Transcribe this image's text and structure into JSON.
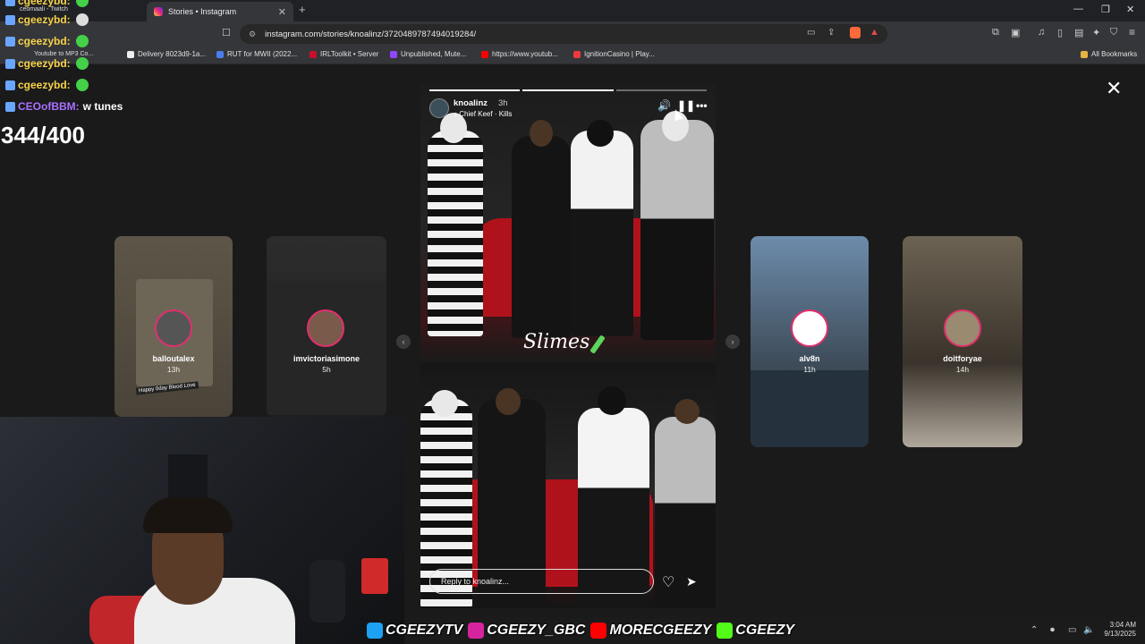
{
  "browser": {
    "tab_title": "Stories • Instagram",
    "tab_close": "✕",
    "new_tab": "+",
    "url": "instagram.com/stories/knoalinz/3720489787494019284/",
    "bookmarks": [
      {
        "label": "Delivery 8023d9-1a..."
      },
      {
        "label": "RUT for MWII (2022..."
      },
      {
        "label": "IRLToolkit • Server"
      },
      {
        "label": "Unpublished, Mute..."
      },
      {
        "label": "https://www.youtub..."
      },
      {
        "label": "IgnitionCasino | Play..."
      }
    ],
    "all_bookmarks": "All Bookmarks"
  },
  "overlay": {
    "small_lines": [
      "ceomaali - Twitch",
      "Youtube to MP3 Co..."
    ],
    "chat": [
      {
        "name": "cgeezybd:",
        "message": ""
      },
      {
        "name": "cgeezybd:",
        "message": ""
      },
      {
        "name": "cgeezybd:",
        "message": ""
      },
      {
        "name": "cgeezybd:",
        "message": ""
      },
      {
        "name": "CEOofBBM:",
        "message": "w tunes"
      }
    ],
    "counter": "344/400"
  },
  "story": {
    "username": "knoalinz",
    "time": "3h",
    "song": "Chief Keef · Kills",
    "caption": "Slimes",
    "reply_placeholder": "Reply to knoalinz...",
    "progress": {
      "segments": 3,
      "active": 2
    }
  },
  "side_stories": [
    {
      "user": "balloutalex",
      "time": "13h",
      "caption": "Happy 0day Blood Love"
    },
    {
      "user": "imvictoriasimone",
      "time": "5h"
    },
    {
      "user": "alv8n",
      "time": "11h"
    },
    {
      "user": "doitforyae",
      "time": "14h"
    }
  ],
  "socials": [
    {
      "handle": "CGEEZYTV",
      "color": "#1da1f2"
    },
    {
      "handle": "CGEEZY_GBC",
      "color": "#d6249f"
    },
    {
      "handle": "MORECGEEZY",
      "color": "#ff0000"
    },
    {
      "handle": "CGEEZY",
      "color": "#53fc18"
    }
  ],
  "taskbar": {
    "time": "3:04 AM",
    "date": "9/13/2025"
  }
}
